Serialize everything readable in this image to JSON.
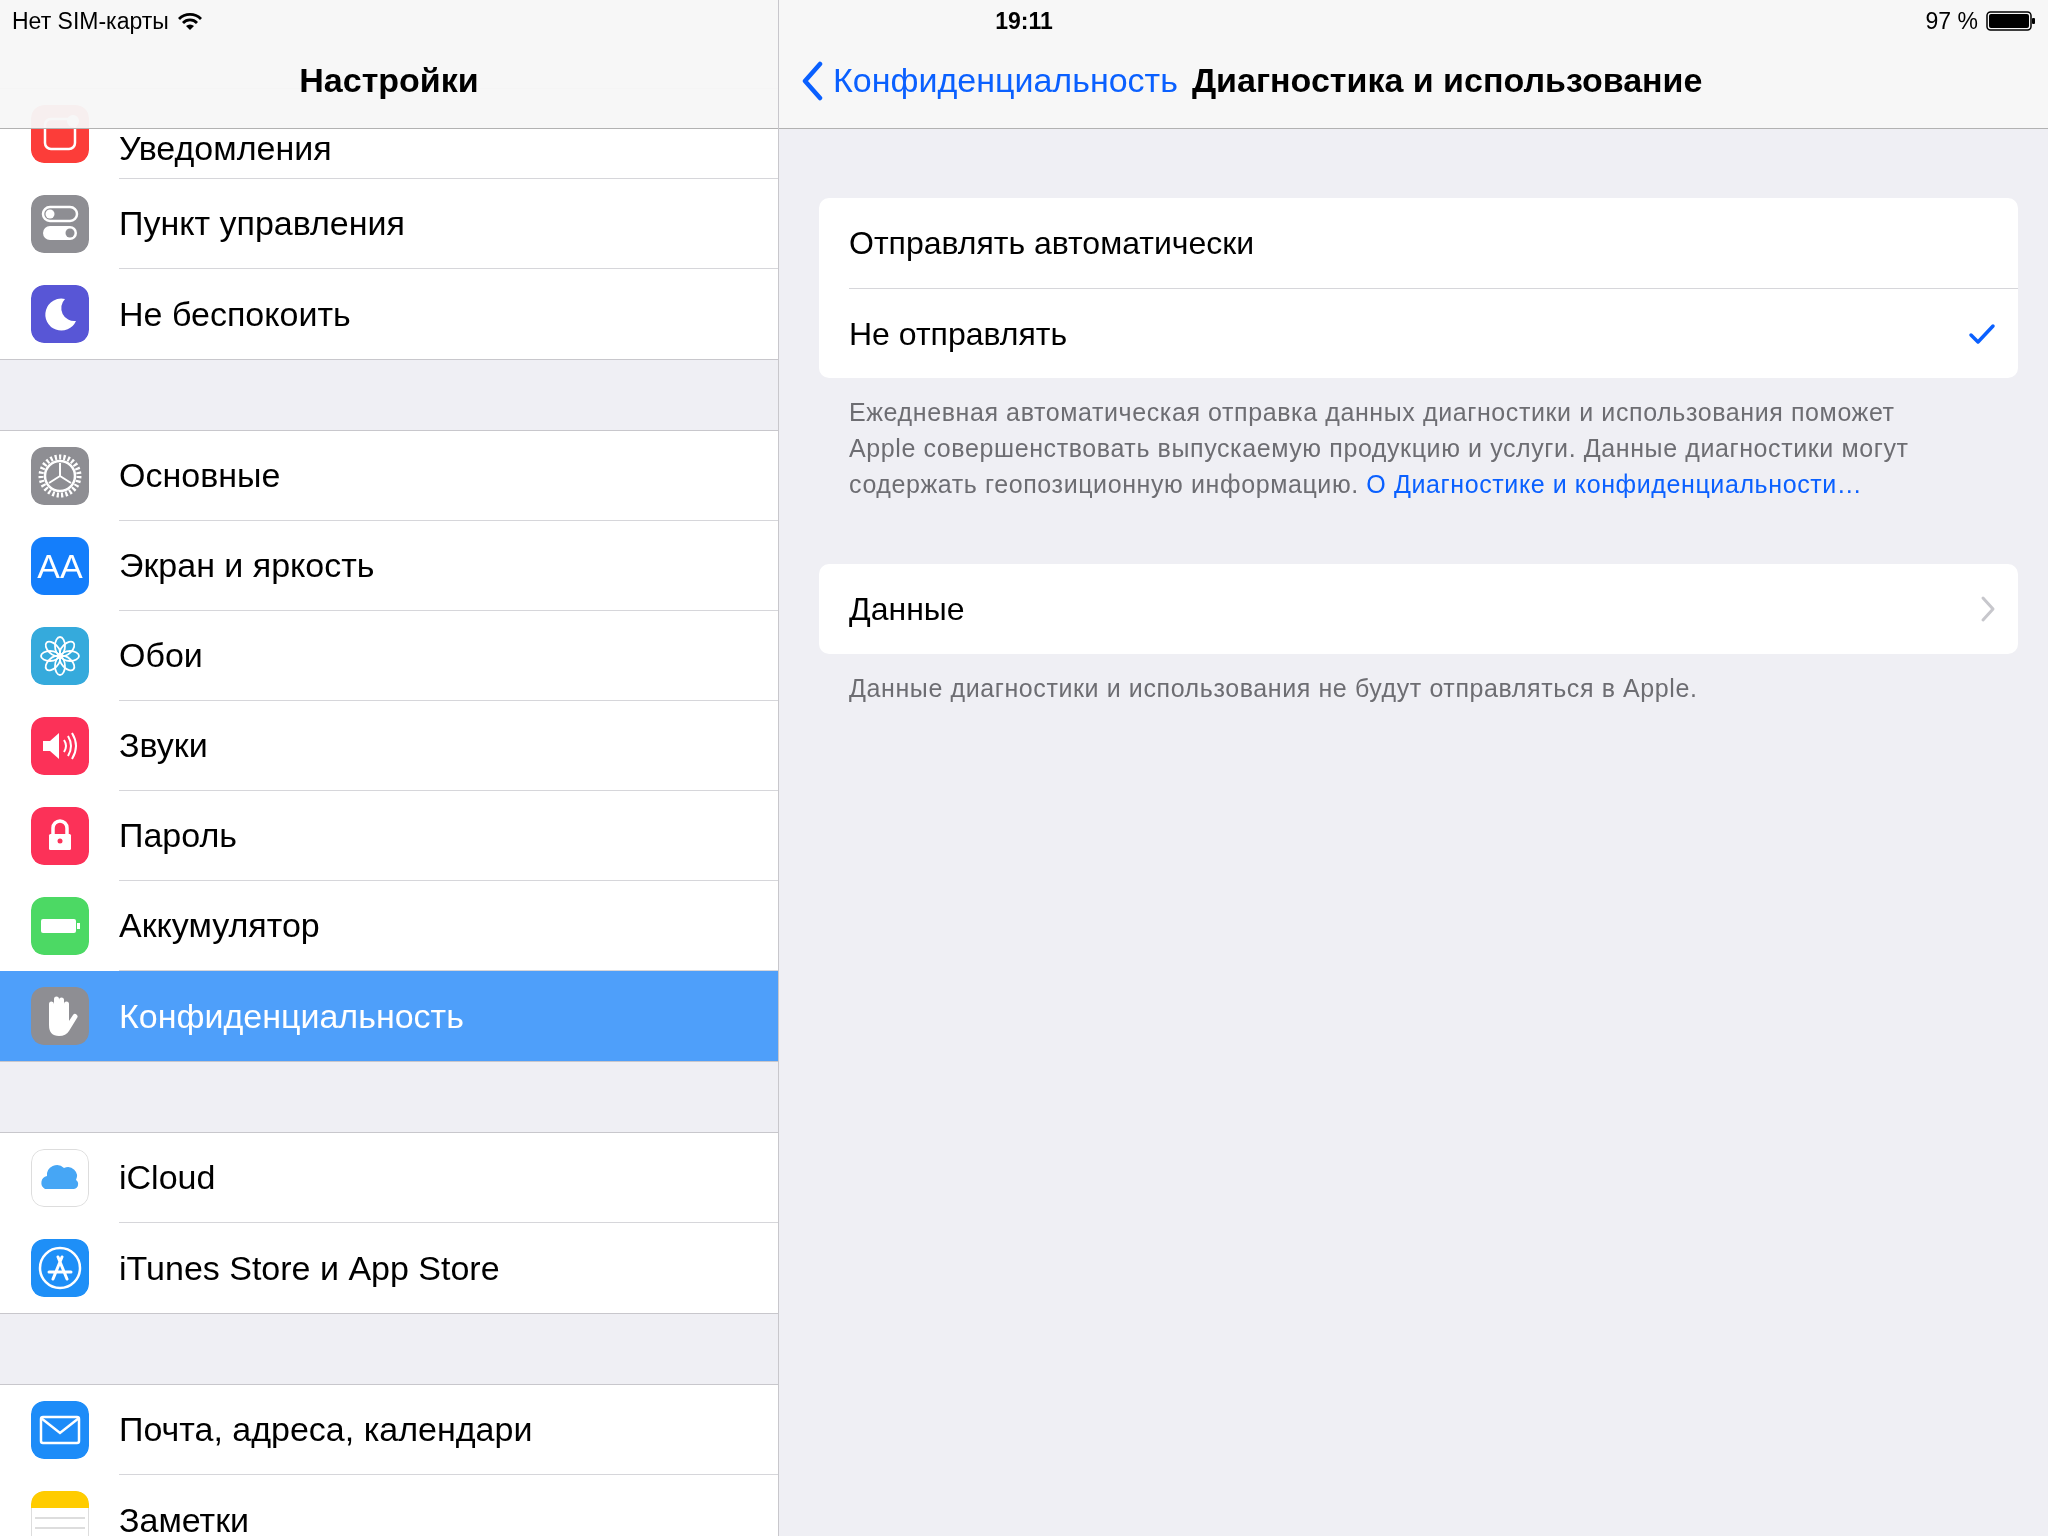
{
  "status_bar": {
    "carrier": "Нет SIM-карты",
    "time": "19:11",
    "battery_text": "97 %"
  },
  "sidebar": {
    "title": "Настройки",
    "groups": [
      {
        "items": [
          {
            "label": "Уведомления",
            "selected": false
          },
          {
            "label": "Пункт управления",
            "selected": false
          },
          {
            "label": "Не беспокоить",
            "selected": false
          }
        ]
      },
      {
        "items": [
          {
            "label": "Основные",
            "selected": false
          },
          {
            "label": "Экран и яркость",
            "selected": false,
            "icon_text": "AA"
          },
          {
            "label": "Обои",
            "selected": false
          },
          {
            "label": "Звуки",
            "selected": false
          },
          {
            "label": "Пароль",
            "selected": false
          },
          {
            "label": "Аккумулятор",
            "selected": false
          },
          {
            "label": "Конфиденциальность",
            "selected": true
          }
        ]
      },
      {
        "items": [
          {
            "label": "iCloud",
            "selected": false
          },
          {
            "label": "iTunes Store и App Store",
            "selected": false
          }
        ]
      },
      {
        "items": [
          {
            "label": "Почта, адреса, календари",
            "selected": false
          },
          {
            "label": "Заметки",
            "selected": false
          }
        ]
      }
    ]
  },
  "detail": {
    "back_label": "Конфиденциальность",
    "title": "Диагностика и использование",
    "options": [
      {
        "label": "Отправлять автоматически",
        "selected": false
      },
      {
        "label": "Не отправлять",
        "selected": true
      }
    ],
    "footer": "Ежедневная автоматическая отправка данных диагностики и использования поможет Apple совершенствовать выпускаемую продукцию и услуги. Данные диагностики могут содержать геопозиционную информацию.",
    "footer_link": "О Диагностике и конфиденциальности…",
    "data_row": {
      "label": "Данные"
    },
    "data_footer": "Данные диагностики и использования не будут отправляться в Apple."
  }
}
